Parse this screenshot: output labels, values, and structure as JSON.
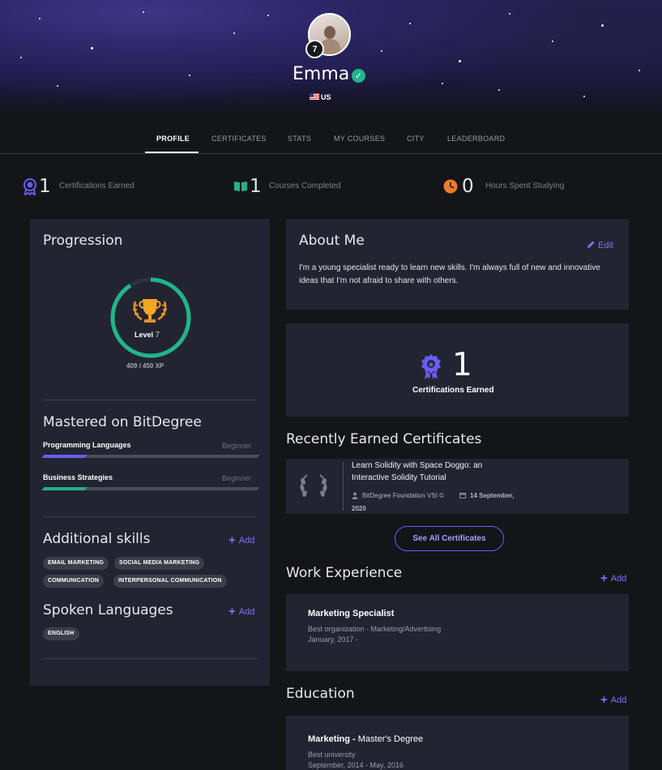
{
  "profile": {
    "name": "Emma",
    "level_badge": "7",
    "country": "US"
  },
  "tabs": [
    {
      "label": "PROFILE",
      "active": true
    },
    {
      "label": "CERTIFICATES"
    },
    {
      "label": "STATS"
    },
    {
      "label": "MY COURSES"
    },
    {
      "label": "CITY"
    },
    {
      "label": "LEADERBOARD"
    }
  ],
  "stats": {
    "certifications": {
      "value": "1",
      "label": "Certifications Earned"
    },
    "courses": {
      "value": "1",
      "label": "Courses Completed"
    },
    "hours": {
      "value": "0",
      "label": "Hours Spent Studying"
    }
  },
  "progression": {
    "title": "Progression",
    "level_word": "Level",
    "level_value": "7",
    "xp_text": "409 / 450 XP",
    "xp_current": 409,
    "xp_max": 450
  },
  "mastered": {
    "title": "Mastered on BitDegree",
    "skills": [
      {
        "name": "Programming Languages",
        "level": "Beginner",
        "fill": 0.2
      },
      {
        "name": "Business Strategies",
        "level": "Beginner",
        "fill": 0.2
      }
    ]
  },
  "additional_skills": {
    "title": "Additional skills",
    "add_label": "Add",
    "chips": [
      "EMAIL MARKETING",
      "SOCIAL MEDIA MARKETING",
      "COMMUNICATION",
      "INTERPERSONAL COMMUNICATION"
    ]
  },
  "spoken_languages": {
    "title": "Spoken Languages",
    "add_label": "Add",
    "chips": [
      "ENGLISH"
    ]
  },
  "about": {
    "title": "About Me",
    "edit_label": "Edit",
    "text": "I'm a young specialist ready to learn new skills. I'm always full of new and innovative ideas that I'm not afraid to share with others."
  },
  "cert_summary": {
    "count": "1",
    "label": "Certifications Earned"
  },
  "recent_certs": {
    "title": "Recently Earned Certificates",
    "items": [
      {
        "title": "Learn Solidity with Space Doggo: an Interactive Solidity Tutorial",
        "issuer": "BitDegree Foundation VSI ©",
        "date": "14 September,",
        "year": "2020"
      }
    ],
    "see_all_label": "See All Certificates"
  },
  "work": {
    "title": "Work Experience",
    "add_label": "Add",
    "items": [
      {
        "title": "Marketing Specialist",
        "org": "Best organization - Marketing/Advertising",
        "dates": "January, 2017 -"
      }
    ]
  },
  "education": {
    "title": "Education",
    "add_label": "Add",
    "items": [
      {
        "field": "Marketing -",
        "degree": "Master's Degree",
        "school": "Best university",
        "dates": "September, 2014 - May, 2016"
      }
    ]
  },
  "colors": {
    "accent": "#7e72ff",
    "progress_ring": "#21b58c",
    "verified": "#21b58c",
    "skill_bar_1": "#6a5df2",
    "skill_bar_2": "#27b08a",
    "card_bg": "#222531",
    "page_bg": "#141519"
  }
}
